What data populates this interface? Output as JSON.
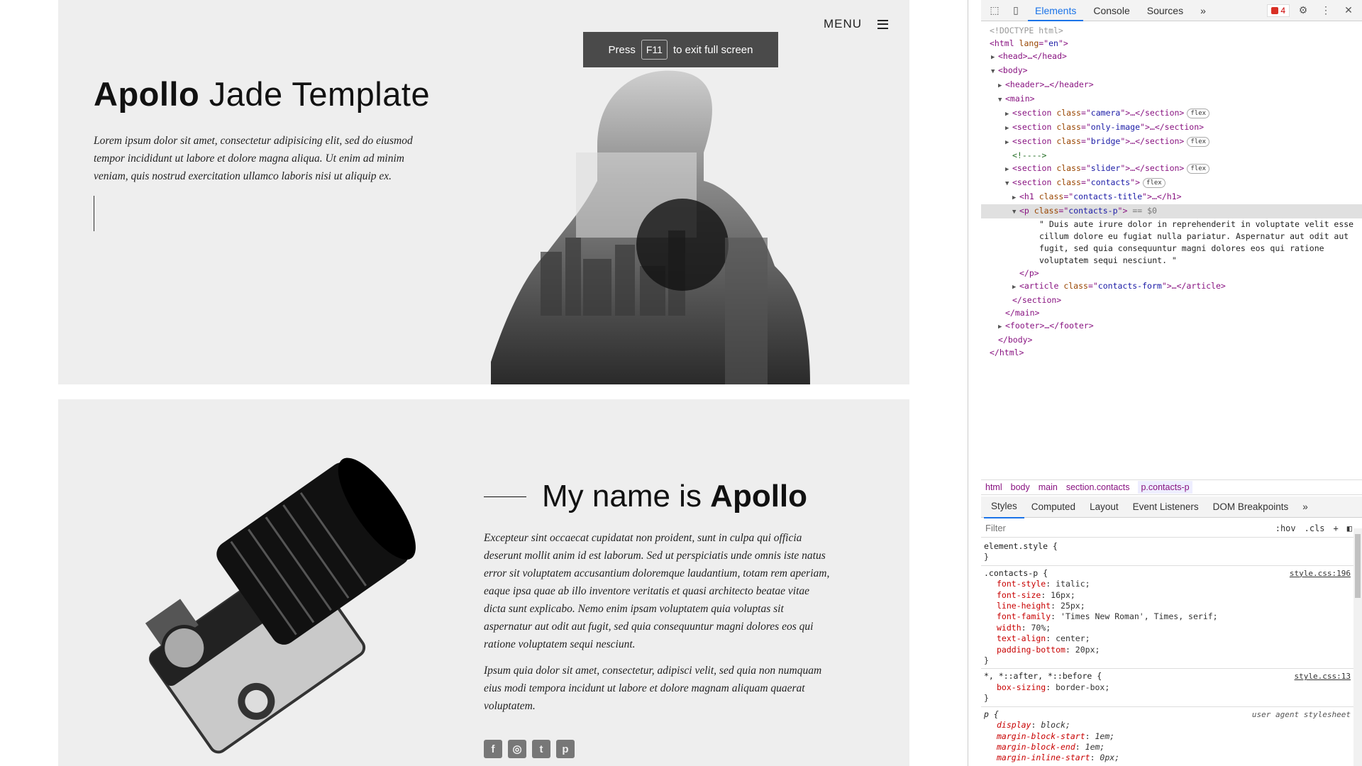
{
  "page": {
    "menu_label": "MENU",
    "hero": {
      "title_bold": "Apollo",
      "title_light": " Jade Template",
      "text": "Lorem ipsum dolor sit amet, consectetur adipisicing elit, sed do eiusmod tempor incididunt ut labore et dolore magna aliqua. Ut enim ad minim veniam, quis nostrud exercitation ullamco laboris nisi ut aliquip ex."
    },
    "fullscreen_toast": {
      "before": "Press",
      "key": "F11",
      "after": "to exit full screen"
    },
    "about": {
      "title_light": "My name is ",
      "title_bold": "Apollo",
      "p1": "Excepteur sint occaecat cupidatat non proident, sunt in culpa qui officia deserunt mollit anim id est laborum. Sed ut perspiciatis unde omnis iste natus error sit voluptatem accusantium doloremque laudantium, totam rem aperiam, eaque ipsa quae ab illo inventore veritatis et quasi architecto beatae vitae dicta sunt explicabo. Nemo enim ipsam voluptatem quia voluptas sit aspernatur aut odit aut fugit, sed quia consequuntur magni dolores eos qui ratione voluptatem sequi nesciunt.",
      "p2": "Ipsum quia dolor sit amet, consectetur, adipisci velit, sed quia non numquam eius modi tempora incidunt ut labore et dolore magnam aliquam quaerat voluptatem.",
      "socials": [
        {
          "icon": "facebook-icon",
          "glyph": "f"
        },
        {
          "icon": "instagram-icon",
          "glyph": "◎"
        },
        {
          "icon": "twitter-icon",
          "glyph": "t"
        },
        {
          "icon": "pinterest-icon",
          "glyph": "p"
        }
      ]
    }
  },
  "devtools": {
    "tabs": [
      "Elements",
      "Console",
      "Sources"
    ],
    "more": "»",
    "error_count": "4",
    "dom": {
      "doctype": "<!DOCTYPE html>",
      "html_lang": "en",
      "sections": [
        "camera",
        "only-image",
        "bridge",
        "slider",
        "contacts"
      ],
      "flex_badge": "flex",
      "comment": "<!---->",
      "h1_class": "contacts-title",
      "p_class": "contacts-p",
      "p_marker": "== $0",
      "p_text": "\" Duis aute irure dolor in reprehenderit in voluptate velit esse cillum dolore eu fugiat nulla pariatur. Aspernatur aut odit aut fugit, sed quia consequuntur magni dolores eos qui ratione voluptatem sequi nesciunt. \"",
      "article_class": "contacts-form"
    },
    "breadcrumbs": [
      "html",
      "body",
      "main",
      "section.contacts",
      "p.contacts-p"
    ],
    "subtabs": [
      "Styles",
      "Computed",
      "Layout",
      "Event Listeners",
      "DOM Breakpoints"
    ],
    "filter_placeholder": "Filter",
    "filter_tools": [
      ":hov",
      ".cls",
      "+"
    ],
    "rules": {
      "element": "element.style {",
      "contacts": {
        "selector": ".contacts-p {",
        "source": "style.css:196",
        "decls": [
          [
            "font-style",
            "italic;"
          ],
          [
            "font-size",
            "16px;"
          ],
          [
            "line-height",
            "25px;"
          ],
          [
            "font-family",
            "'Times New Roman', Times, serif;"
          ],
          [
            "width",
            "70%;"
          ],
          [
            "text-align",
            "center;"
          ],
          [
            "padding-bottom",
            "20px;"
          ]
        ]
      },
      "universal": {
        "selector": "*, *::after, *::before {",
        "source": "style.css:13",
        "decls": [
          [
            "box-sizing",
            "border-box;"
          ]
        ]
      },
      "p": {
        "selector": "p {",
        "source": "user agent stylesheet",
        "decls": [
          [
            "display",
            "block;"
          ],
          [
            "margin-block-start",
            "1em;"
          ],
          [
            "margin-block-end",
            "1em;"
          ],
          [
            "margin-inline-start",
            "0px;"
          ]
        ]
      },
      "close": "}"
    }
  }
}
